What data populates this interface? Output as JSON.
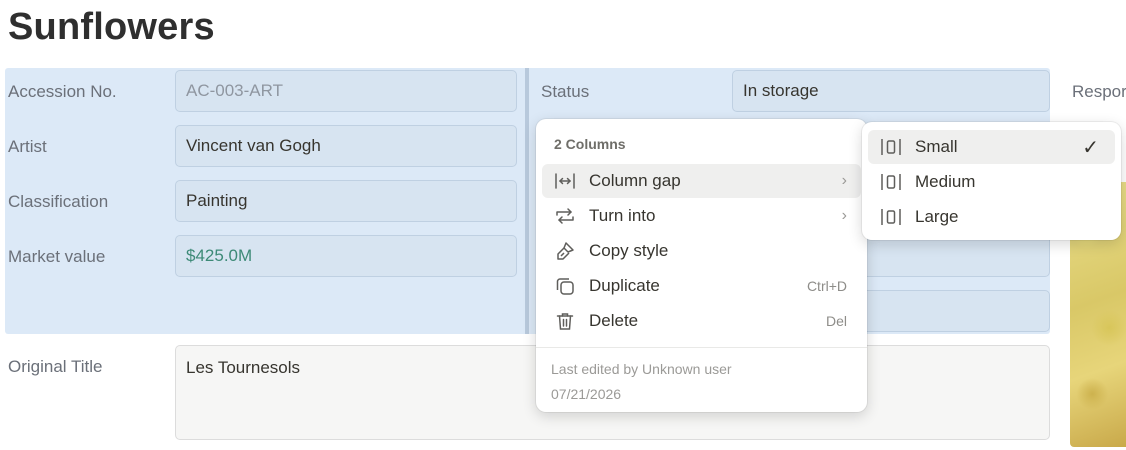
{
  "page": {
    "title": "Sunflowers"
  },
  "properties": {
    "accession_label": "Accession No.",
    "accession_value": "AC-003-ART",
    "artist_label": "Artist",
    "artist_value": "Vincent van Gogh",
    "classification_label": "Classification",
    "classification_value": "Painting",
    "market_label": "Market value",
    "market_value": "$425.0M",
    "status_label": "Status",
    "status_value": "In storage",
    "responsible_label_partial": "Respor",
    "original_title_label": "Original Title",
    "original_title_value": "Les Tournesols"
  },
  "context_menu": {
    "header": "2 Columns",
    "items": [
      {
        "label": "Column gap",
        "icon": "column-gap-icon",
        "has_submenu": true,
        "shortcut": ""
      },
      {
        "label": "Turn into",
        "icon": "turn-into-icon",
        "has_submenu": true,
        "shortcut": ""
      },
      {
        "label": "Copy style",
        "icon": "paint-brush-icon",
        "has_submenu": false,
        "shortcut": ""
      },
      {
        "label": "Duplicate",
        "icon": "duplicate-icon",
        "has_submenu": false,
        "shortcut": "Ctrl+D"
      },
      {
        "label": "Delete",
        "icon": "trash-icon",
        "has_submenu": false,
        "shortcut": "Del"
      }
    ],
    "meta_edited": "Last edited by Unknown user",
    "meta_date": "07/21/2026"
  },
  "gap_submenu": {
    "items": [
      {
        "label": "Small",
        "selected": true,
        "icon": "gap-small-icon"
      },
      {
        "label": "Medium",
        "selected": false,
        "icon": "gap-medium-icon"
      },
      {
        "label": "Large",
        "selected": false,
        "icon": "gap-large-icon"
      }
    ],
    "check_glyph": "✓"
  },
  "colors": {
    "block_highlight": "#dce9f7",
    "money_text": "#3d8a77",
    "menu_hover": "#efefee"
  }
}
